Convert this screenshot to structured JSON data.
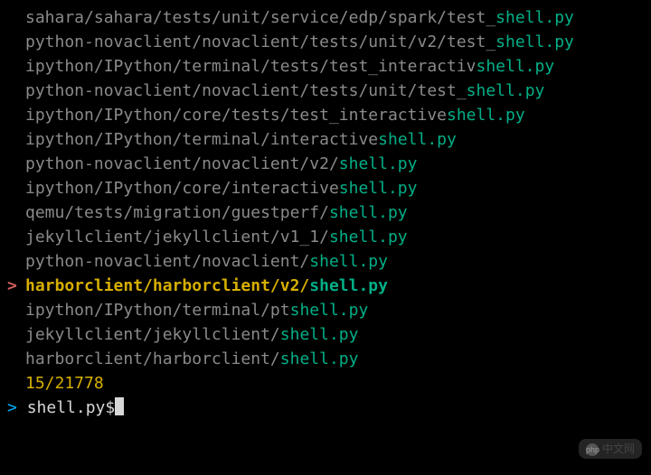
{
  "results": [
    {
      "prefix": "sahara/sahara/tests/unit/service/edp/spark/test_",
      "match": "shell.py",
      "selected": false
    },
    {
      "prefix": "python-novaclient/novaclient/tests/unit/v2/test_",
      "match": "shell.py",
      "selected": false
    },
    {
      "prefix": "ipython/IPython/terminal/tests/test_interactiv",
      "match": "shell.py",
      "selected": false
    },
    {
      "prefix": "python-novaclient/novaclient/tests/unit/test_",
      "match": "shell.py",
      "selected": false
    },
    {
      "prefix": "ipython/IPython/core/tests/test_interactive",
      "match": "shell.py",
      "selected": false
    },
    {
      "prefix": "ipython/IPython/terminal/interactive",
      "match": "shell.py",
      "selected": false
    },
    {
      "prefix": "python-novaclient/novaclient/v2/",
      "match": "shell.py",
      "selected": false
    },
    {
      "prefix": "ipython/IPython/core/interactive",
      "match": "shell.py",
      "selected": false
    },
    {
      "prefix": "qemu/tests/migration/guestperf/",
      "match": "shell.py",
      "selected": false
    },
    {
      "prefix": "jekyllclient/jekyllclient/v1_1/",
      "match": "shell.py",
      "selected": false
    },
    {
      "prefix": "python-novaclient/novaclient/",
      "match": "shell.py",
      "selected": false
    },
    {
      "prefix": "harborclient/harborclient/v2/",
      "match": "shell.py",
      "selected": true
    },
    {
      "prefix": "ipython/IPython/terminal/pt",
      "match": "shell.py",
      "selected": false
    },
    {
      "prefix": "jekyllclient/jekyllclient/",
      "match": "shell.py",
      "selected": false
    },
    {
      "prefix": "harborclient/harborclient/",
      "match": "shell.py",
      "selected": false
    }
  ],
  "counter": "15/21778",
  "prompt": {
    "caret": ">",
    "query": "shell.py$"
  },
  "watermark": "中文网"
}
